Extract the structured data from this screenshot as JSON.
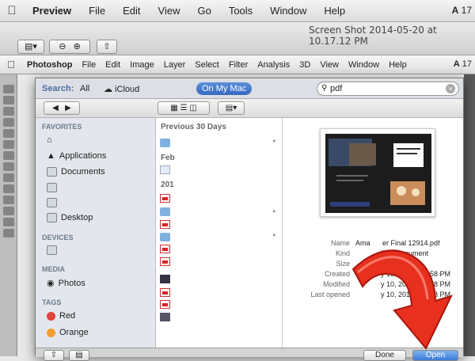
{
  "mac_menubar": {
    "items": [
      "Preview",
      "File",
      "Edit",
      "View",
      "Go",
      "Tools",
      "Window",
      "Help"
    ],
    "right": "17"
  },
  "preview_window": {
    "title": "Screen Shot 2014-05-20 at 10.17.12 PM"
  },
  "photoshop_menubar": {
    "items": [
      "Photoshop",
      "File",
      "Edit",
      "Image",
      "Layer",
      "Select",
      "Filter",
      "Analysis",
      "3D",
      "View",
      "Window",
      "Help"
    ],
    "right": "17"
  },
  "open_dialog": {
    "search_bar": {
      "label": "Search:",
      "scope_all": "All",
      "scope_icloud": "iCloud",
      "scope_mac": "On My Mac",
      "query": "pdf"
    },
    "sidebar": {
      "favorites_header": "FAVORITES",
      "favorites": [
        "Applications",
        "Documents",
        "Desktop"
      ],
      "devices_header": "DEVICES",
      "media_header": "MEDIA",
      "media": [
        "Photos"
      ],
      "tags_header": "TAGS",
      "tags": [
        {
          "label": "Red",
          "color": "#e0433a"
        },
        {
          "label": "Orange",
          "color": "#f0a030"
        }
      ]
    },
    "results": {
      "group1": "Previous 30 Days",
      "group2": "Feb",
      "group3": "201"
    },
    "file_info": {
      "name_key": "Name",
      "name_value": "Ama",
      "name_value_end": "er Final 12914.pdf",
      "kind_key": "Kind",
      "kind_value": "PDF document",
      "size_key": "Size",
      "size_value": "B",
      "created_key": "Created",
      "created_value": "y 10, 2014 at 5:58 PM",
      "modified_key": "Modified",
      "modified_value": "y 10, 2014 at 5:58 PM",
      "opened_key": "Last opened",
      "opened_value": "y 10, 2014 at 5:58 PM"
    },
    "buttons": {
      "done": "Done",
      "open": "Open"
    }
  }
}
